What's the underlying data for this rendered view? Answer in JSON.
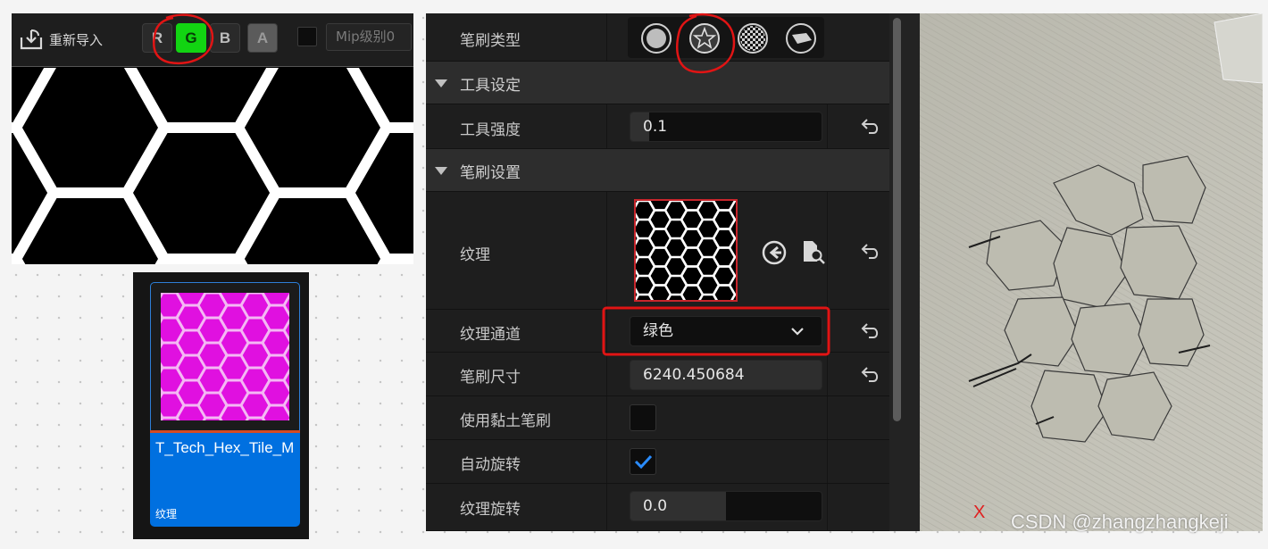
{
  "viewer": {
    "reimport_label": "重新导入",
    "channels": [
      {
        "key": "r",
        "label": "R",
        "active": false
      },
      {
        "key": "g",
        "label": "G",
        "active": true
      },
      {
        "key": "b",
        "label": "B",
        "active": false
      },
      {
        "key": "a",
        "label": "A",
        "active": false
      }
    ],
    "mip_label": "Mip级别0",
    "active_channel_color": "#12d412"
  },
  "asset": {
    "name": "T_Tech_Hex_Tile_M",
    "type": "纹理",
    "card_color": "#0070e0",
    "thumbnail_color": "#e010e0"
  },
  "panel": {
    "brush_type": {
      "label": "笔刷类型",
      "options": [
        "circle-icon",
        "star-icon",
        "checker-icon",
        "smooth-icon"
      ],
      "selected": "star-icon"
    },
    "tool_settings": {
      "section_label": "工具设定",
      "strength_label": "工具强度",
      "strength_value": "0.1",
      "strength_fraction": 0.1
    },
    "brush_settings": {
      "section_label": "笔刷设置",
      "texture_label": "纹理",
      "texture_channel_label": "纹理通道",
      "texture_channel_value": "绿色",
      "brush_size_label": "笔刷尺寸",
      "brush_size_value": "6240.450684",
      "clay_brush_label": "使用黏土笔刷",
      "clay_brush_checked": false,
      "auto_rotate_label": "自动旋转",
      "auto_rotate_checked": true,
      "texture_rotation_label": "纹理旋转",
      "texture_rotation_value": "0.0",
      "texture_rotation_fraction": 0.5
    }
  },
  "viewport": {
    "axis_label": "X"
  },
  "watermark": "CSDN @zhangzhangkeji"
}
